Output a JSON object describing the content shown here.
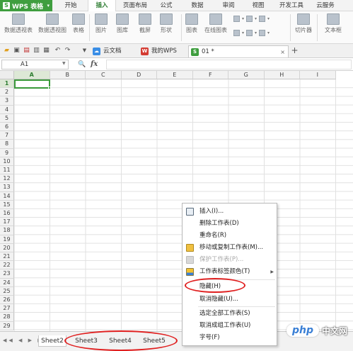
{
  "app": {
    "menu_label": "WPS 表格",
    "logo_letter": "S"
  },
  "ribbon": {
    "tabs": [
      "开始",
      "插入",
      "页面布局",
      "公式",
      "数据",
      "审阅",
      "视图",
      "开发工具",
      "云服务"
    ],
    "active_tab": "插入",
    "items": [
      {
        "label": "数据透视表",
        "icon": "pivot-table-icon"
      },
      {
        "label": "数据透视图",
        "icon": "pivot-chart-icon"
      },
      {
        "label": "表格",
        "icon": "table-icon"
      },
      {
        "label": "图片",
        "icon": "picture-icon"
      },
      {
        "label": "图库",
        "icon": "gallery-icon"
      },
      {
        "label": "截屏",
        "icon": "screenshot-icon"
      },
      {
        "label": "形状",
        "icon": "shape-icon"
      },
      {
        "label": "图表",
        "icon": "chart-icon"
      },
      {
        "label": "在线图表",
        "icon": "online-chart-icon"
      },
      {
        "label": "切片器",
        "icon": "slicer-icon"
      },
      {
        "label": "文本框",
        "icon": "textbox-icon"
      }
    ]
  },
  "doc_tabs": [
    {
      "label": "云文档",
      "icon": "cloud-icon",
      "color": "#3a8ee6"
    },
    {
      "label": "我的WPS",
      "icon": "wps-icon",
      "color": "#d43c33"
    },
    {
      "label": "01 *",
      "icon": "sheet-doc-icon",
      "color": "#3f9e3f"
    }
  ],
  "doc_tab_close": "×",
  "doc_tab_add": "+",
  "formula_bar": {
    "cell_ref": "A1",
    "fx_label": "fx",
    "zoom_glyph": "🔍",
    "value": ""
  },
  "grid": {
    "columns": [
      "A",
      "B",
      "C",
      "D",
      "E",
      "F",
      "G",
      "H",
      "I"
    ],
    "rows": [
      "1",
      "2",
      "3",
      "4",
      "5",
      "6",
      "7",
      "8",
      "9",
      "10",
      "11",
      "12",
      "13",
      "14",
      "15",
      "16",
      "17",
      "18",
      "19",
      "20",
      "21",
      "22",
      "23",
      "24",
      "25",
      "26",
      "27",
      "28",
      "29"
    ],
    "active_cell": "A1"
  },
  "sheet_tabs": [
    "Sheet2",
    "Sheet3",
    "Sheet4",
    "Sheet5"
  ],
  "context_menu": [
    {
      "label": "插入(I)...",
      "icon": "insert-sheet-icon",
      "disabled": false
    },
    {
      "label": "删除工作表(D)",
      "icon": "",
      "disabled": false
    },
    {
      "label": "重命名(R)",
      "icon": "",
      "disabled": false
    },
    {
      "label": "移动或复制工作表(M)...",
      "icon": "move-copy-icon",
      "disabled": false
    },
    {
      "label": "保护工作表(P)...",
      "icon": "protect-icon",
      "disabled": true
    },
    {
      "label": "工作表标签颜色(T)",
      "icon": "tab-color-icon",
      "disabled": false,
      "submenu": true
    },
    {
      "label": "隐藏(H)",
      "icon": "",
      "disabled": false
    },
    {
      "label": "取消隐藏(U)...",
      "icon": "",
      "disabled": false
    },
    {
      "label": "选定全部工作表(S)",
      "icon": "",
      "disabled": false
    },
    {
      "label": "取消成组工作表(U)",
      "icon": "",
      "disabled": false
    },
    {
      "label": "字号(F)",
      "icon": "",
      "disabled": false
    }
  ],
  "watermark": {
    "logo": "php",
    "text": "中文网"
  },
  "colors": {
    "accent_green": "#3f9e3f",
    "annotation_red": "#e02020"
  }
}
